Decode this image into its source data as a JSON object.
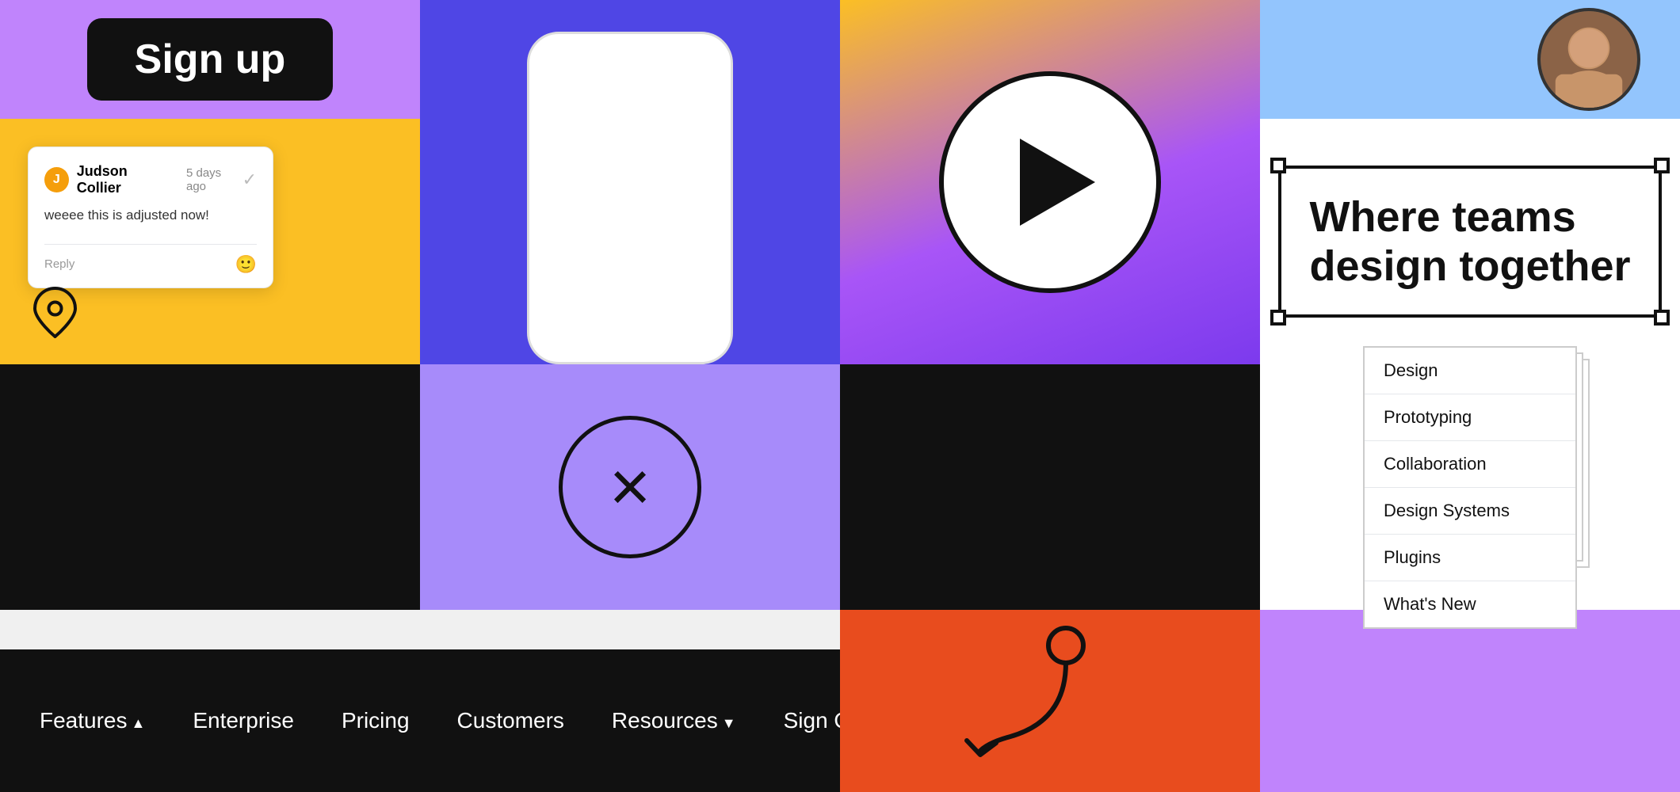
{
  "signup": {
    "button_label": "Sign up"
  },
  "comment": {
    "avatar_initial": "J",
    "username": "Judson Collier",
    "time_ago": "5 days ago",
    "text": "weeee this is adjusted now!",
    "reply_label": "Reply"
  },
  "hero": {
    "line1": "Where teams",
    "line2": "design together"
  },
  "menu_items": [
    {
      "label": "Design"
    },
    {
      "label": "Prototyping"
    },
    {
      "label": "Collaboration"
    },
    {
      "label": "Design Systems"
    },
    {
      "label": "Plugins"
    },
    {
      "label": "What's New"
    }
  ],
  "nav": {
    "features": "Features",
    "enterprise": "Enterprise",
    "pricing": "Pricing",
    "customers": "Customers",
    "resources": "Resources",
    "sign_out": "Sign Out"
  },
  "colors": {
    "purple_light": "#c084fc",
    "purple_mid": "#a78bfa",
    "indigo": "#4f46e5",
    "yellow": "#fbbf24",
    "black": "#111111",
    "blue_light": "#93c5fd",
    "red_orange": "#e84c1e",
    "white": "#ffffff"
  }
}
